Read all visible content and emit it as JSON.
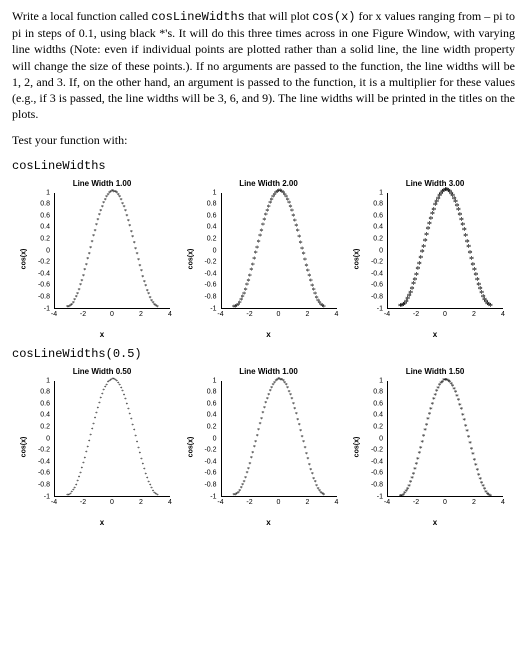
{
  "prose": {
    "p1_a": "Write a local function called ",
    "p1_b": "cosLineWidths",
    "p1_c": " that will plot ",
    "p1_d": "cos(x)",
    "p1_e": " for x values ranging from – pi to pi in steps of 0.1, using black *'s. It will do this three times across in one Figure Window, with varying line widths (Note: even if individual points are plotted rather than a solid line, the line width property will change the size of these points.). If no arguments are passed to the function, the line widths will be 1, 2, and 3. If, on the other hand, an argument is passed to the function, it is a multiplier for these values (e.g., if 3 is passed, the line widths will be 3, 6, and 9). The line widths will be printed in the titles on the plots.",
    "p2": "Test your function with:"
  },
  "calls": [
    "cosLineWidths",
    "cosLineWidths(0.5)"
  ],
  "axes": {
    "xlabel": "x",
    "ylabel": "cos(x)",
    "xticks": [
      -4,
      -2,
      0,
      2,
      4
    ],
    "yticks": [
      -1,
      -0.8,
      -0.6,
      -0.4,
      -0.2,
      0,
      0.2,
      0.4,
      0.6,
      0.8,
      1
    ]
  },
  "chart_data": [
    {
      "type": "scatter",
      "title": "Line Width 1.00",
      "line_width": 1.0,
      "series_desc": "y = cos(x), x from -pi to pi step 0.1",
      "xlabel": "x",
      "ylabel": "cos(x)",
      "xlim": [
        -4,
        4
      ],
      "ylim": [
        -1,
        1
      ],
      "marker": "*",
      "color": "#000000"
    },
    {
      "type": "scatter",
      "title": "Line Width 2.00",
      "line_width": 2.0,
      "series_desc": "y = cos(x), x from -pi to pi step 0.1",
      "xlabel": "x",
      "ylabel": "cos(x)",
      "xlim": [
        -4,
        4
      ],
      "ylim": [
        -1,
        1
      ],
      "marker": "*",
      "color": "#000000"
    },
    {
      "type": "scatter",
      "title": "Line Width 3.00",
      "line_width": 3.0,
      "series_desc": "y = cos(x), x from -pi to pi step 0.1",
      "xlabel": "x",
      "ylabel": "cos(x)",
      "xlim": [
        -4,
        4
      ],
      "ylim": [
        -1,
        1
      ],
      "marker": "*",
      "color": "#000000"
    },
    {
      "type": "scatter",
      "title": "Line Width 0.50",
      "line_width": 0.5,
      "series_desc": "y = cos(x), x from -pi to pi step 0.1",
      "xlabel": "x",
      "ylabel": "cos(x)",
      "xlim": [
        -4,
        4
      ],
      "ylim": [
        -1,
        1
      ],
      "marker": "*",
      "color": "#000000"
    },
    {
      "type": "scatter",
      "title": "Line Width 1.00",
      "line_width": 1.0,
      "series_desc": "y = cos(x), x from -pi to pi step 0.1",
      "xlabel": "x",
      "ylabel": "cos(x)",
      "xlim": [
        -4,
        4
      ],
      "ylim": [
        -1,
        1
      ],
      "marker": "*",
      "color": "#000000"
    },
    {
      "type": "scatter",
      "title": "Line Width 1.50",
      "line_width": 1.5,
      "series_desc": "y = cos(x), x from -pi to pi step 0.1",
      "xlabel": "x",
      "ylabel": "cos(x)",
      "xlabel_": "x",
      "xlim": [
        -4,
        4
      ],
      "ylim": [
        -1,
        1
      ],
      "marker": "*",
      "color": "#000000"
    }
  ]
}
